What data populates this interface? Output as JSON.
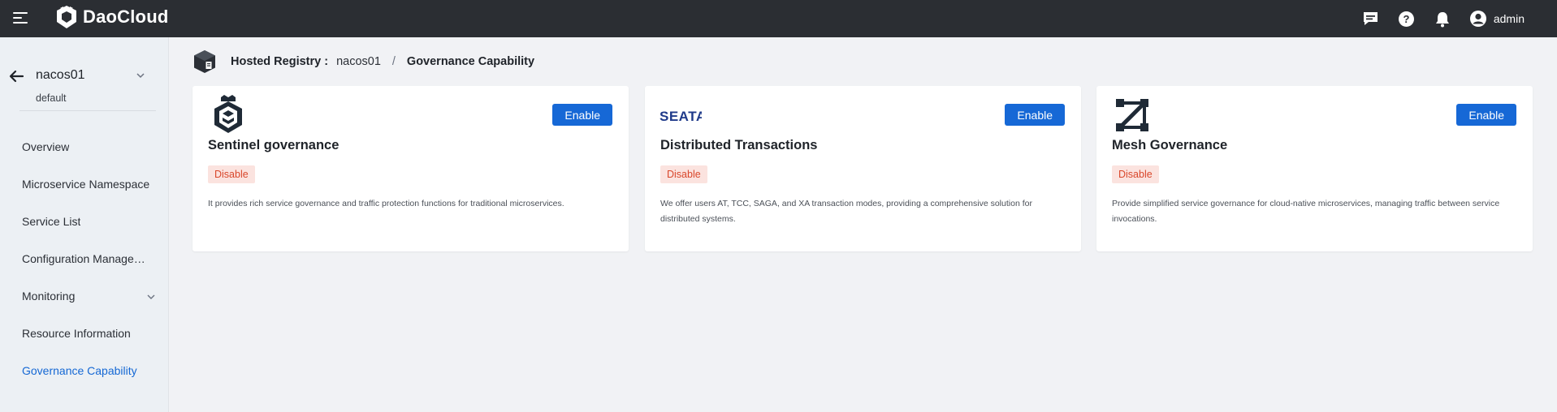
{
  "topbar": {
    "brand": "DaoCloud",
    "user_name": "admin",
    "icons": [
      "menu-icon",
      "chat-icon",
      "help-icon",
      "bell-icon",
      "user-avatar-icon"
    ]
  },
  "sidebar": {
    "namespace": "nacos01",
    "workspace": "default",
    "items": [
      {
        "label": "Overview"
      },
      {
        "label": "Microservice Namespace"
      },
      {
        "label": "Service List"
      },
      {
        "label": "Configuration Manageme..."
      },
      {
        "label": "Monitoring"
      },
      {
        "label": "Resource Information"
      },
      {
        "label": "Governance Capability"
      }
    ],
    "active_item": "Governance Capability"
  },
  "breadcrumb": {
    "label": "Hosted Registry :",
    "namespace": "nacos01",
    "separator": "/",
    "current": "Governance Capability"
  },
  "cards": [
    {
      "logo": "sentinel-logo",
      "title": "Sentinel governance",
      "status": "Disable",
      "button": "Enable",
      "description": "It provides rich service governance and traffic protection functions for traditional microservices."
    },
    {
      "logo": "seata-logo",
      "logo_text": "SEATA",
      "title": "Distributed Transactions",
      "status": "Disable",
      "button": "Enable",
      "description": "We offer users AT, TCC, SAGA, and XA transaction modes, providing a comprehensive solution for distributed systems."
    },
    {
      "logo": "mesh-logo",
      "title": "Mesh Governance",
      "status": "Disable",
      "button": "Enable",
      "description": "Provide simplified service governance for cloud-native microservices, managing traffic between service invocations."
    }
  ],
  "colors": {
    "topbar": "#2b2e33",
    "accent": "#1668d6",
    "badge_bg": "#fbe3df",
    "badge_text": "#d9472b",
    "page_bg": "#f1f2f5"
  }
}
